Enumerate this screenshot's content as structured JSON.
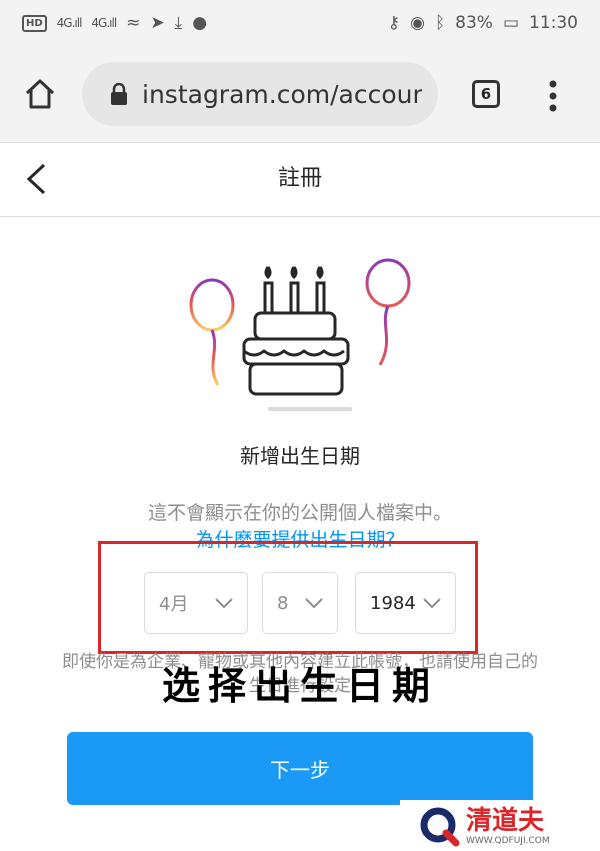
{
  "status": {
    "hd": "HD",
    "signal1": "4G.ıll",
    "signal2": "4G.ıll",
    "battery": "83%",
    "time": "11:30"
  },
  "browser": {
    "url": "instagram.com/accoun",
    "tab_count": "6"
  },
  "header": {
    "title": "註冊"
  },
  "main": {
    "heading": "新增出生日期",
    "description": "這不會顯示在你的公開個人檔案中。",
    "link": "為什麼要提供出生日期？",
    "month": "4月",
    "day": "8",
    "year": "1984",
    "note": "即使你是為企業、寵物或其他內容建立此帳號，也請使用自己的生日進行設定",
    "overlay": "选择出生日期",
    "next_button": "下一步"
  },
  "watermark": {
    "name": "清道夫",
    "site": "WWW.QDFUJI.COM"
  },
  "colors": {
    "accent": "#1a9af6",
    "link": "#0095f6",
    "highlight": "#d9262b"
  }
}
